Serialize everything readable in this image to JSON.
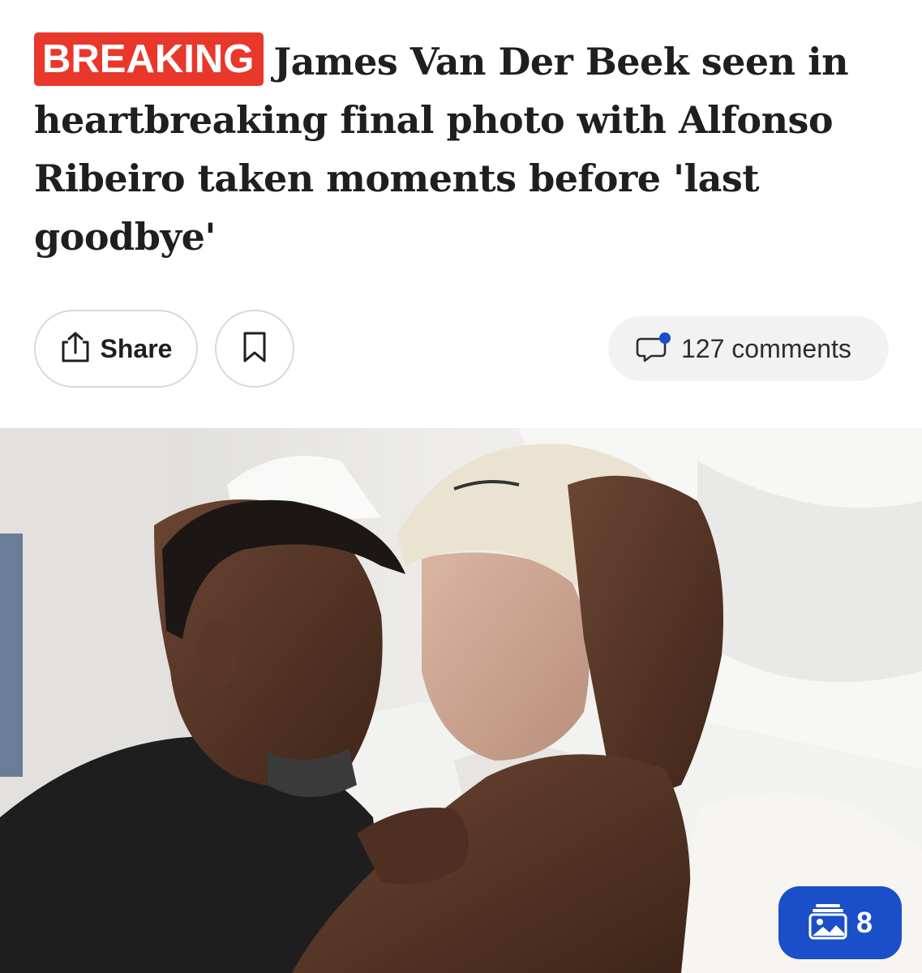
{
  "headline": {
    "badge": "BREAKING",
    "text": "James Van Der Beek seen in heartbreaking final photo with Alfonso Ribeiro taken moments before 'last goodbye'"
  },
  "actions": {
    "share_label": "Share",
    "comments_label": "127 comments"
  },
  "gallery": {
    "count": "8"
  },
  "icons": {
    "share": "share-icon",
    "bookmark": "bookmark-icon",
    "comment": "comment-bubble-icon",
    "gallery": "gallery-icon"
  },
  "colors": {
    "badge": "#e8382b",
    "accent": "#1a4fc9",
    "notification_dot": "#1a4fc9"
  }
}
